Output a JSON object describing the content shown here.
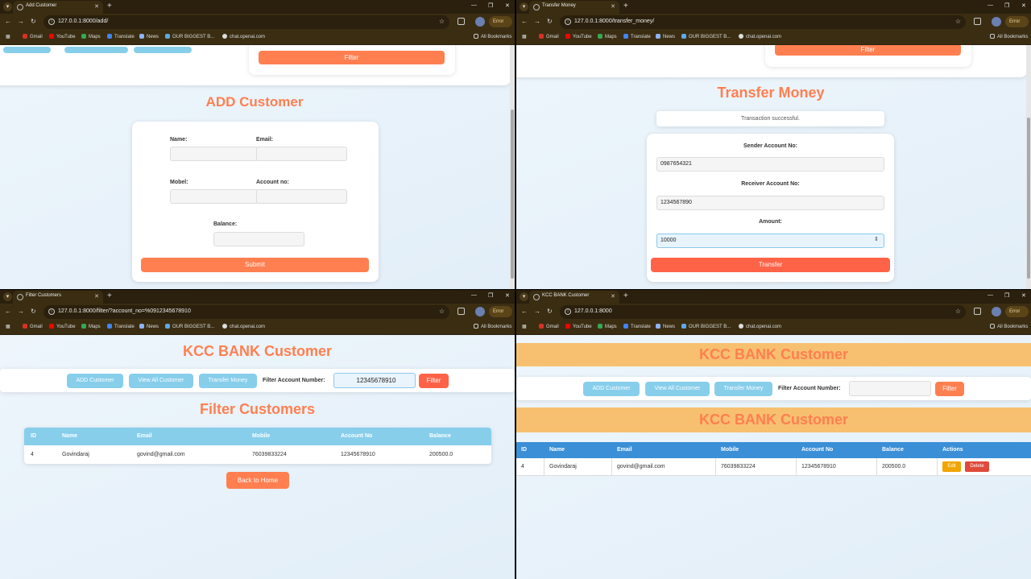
{
  "browser": {
    "bookmarks": [
      "Gmail",
      "YouTube",
      "Maps",
      "Translate",
      "News",
      "OUR BIGGEST B...",
      "chat.openai.com"
    ],
    "all_bookmarks": "All Bookmarks",
    "error_label": "Error",
    "new_tab": "+"
  },
  "w1": {
    "tab_title": "Add Customer",
    "url": "127.0.0.1:8000/add/",
    "filter_label": "Filter",
    "heading": "ADD Customer",
    "name_label": "Name:",
    "email_label": "Email:",
    "mobel_label": "Mobel:",
    "account_label": "Account no:",
    "balance_label": "Balance:",
    "submit_label": "Submit"
  },
  "w2": {
    "tab_title": "Transfer Money",
    "url": "127.0.0.1:8000/transfer_money/",
    "filter_label": "Filter",
    "heading": "Transfer Money",
    "message": "Transaction successful.",
    "sender_label": "Sender Account No:",
    "sender_value": "0987654321",
    "receiver_label": "Receiver Account No:",
    "receiver_value": "1234567890",
    "amount_label": "Amount:",
    "amount_value": "10000",
    "transfer_label": "Transfer"
  },
  "w3": {
    "tab_title": "Filter Customers",
    "url": "127.0.0.1:8000/filter/?account_no=%0912345678910",
    "heading": "KCC BANK Customer",
    "nav": {
      "add": "ADD Customer",
      "view": "View All Customer",
      "transfer": "Transfer Money",
      "filter_label": "Filter Account Number:",
      "filter_value": "12345678910",
      "filter_button": "Filter"
    },
    "subheading": "Filter Customers",
    "table": {
      "headers": [
        "ID",
        "Name",
        "Email",
        "Mobile",
        "Account No",
        "Balance"
      ],
      "rows": [
        [
          "4",
          "Govindaraj",
          "govind@gmail.com",
          "76039833224",
          "12345678910",
          "200500.0"
        ]
      ]
    },
    "back_label": "Back to Home"
  },
  "w4": {
    "tab_title": "KCC BANK Customer",
    "url": "127.0.0.1:8000",
    "heading": "KCC BANK Customer",
    "nav": {
      "add": "ADD Customer",
      "view": "View All Customer",
      "transfer": "Transfer Money",
      "filter_label": "Filter Account Number:",
      "filter_value": "",
      "filter_button": "Filter"
    },
    "subheading": "KCC BANK Customer",
    "table": {
      "headers": [
        "ID",
        "Name",
        "Email",
        "Mobile",
        "Account No",
        "Balance",
        "Actions"
      ],
      "rows": [
        [
          "4",
          "Govindaraj",
          "govind@gmail.com",
          "76039833224",
          "12345678910",
          "200500.0"
        ]
      ]
    },
    "edit_label": "Edit",
    "delete_label": "Delete"
  },
  "colors": {
    "accent_orange": "#ff7f50",
    "sky_blue": "#87ceeb",
    "table_blue": "#3a8fd6",
    "banner": "#f7c070",
    "edit": "#f0a500",
    "delete": "#e04a3a"
  }
}
